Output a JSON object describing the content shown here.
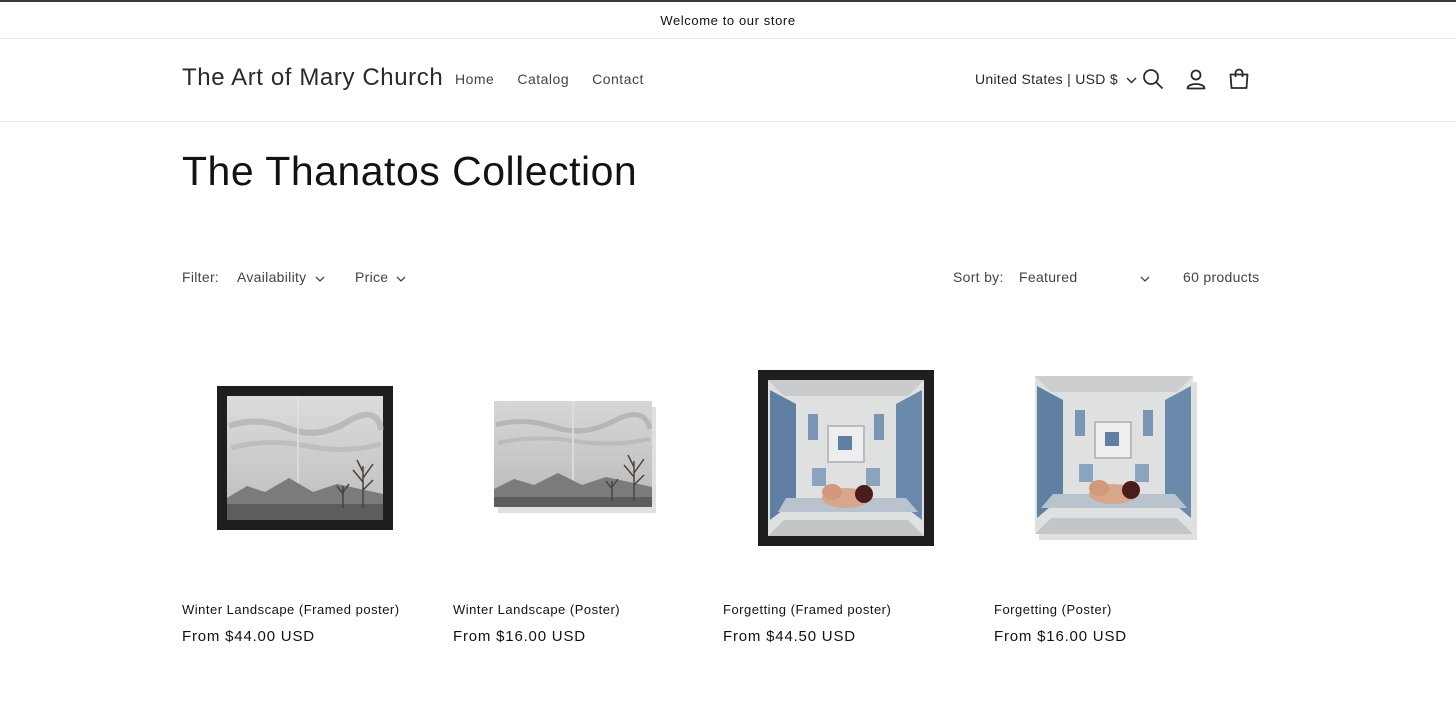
{
  "announcement": {
    "text": "Welcome to our store"
  },
  "header": {
    "logo": "The Art of Mary Church",
    "nav": [
      {
        "label": "Home"
      },
      {
        "label": "Catalog"
      },
      {
        "label": "Contact"
      }
    ],
    "locale": "United States | USD $",
    "icons": [
      "search-icon",
      "account-icon",
      "cart-icon",
      "chevron-down-icon"
    ]
  },
  "collection": {
    "title": "The Thanatos Collection",
    "filter_label": "Filter:",
    "filters": [
      {
        "label": "Availability"
      },
      {
        "label": "Price"
      }
    ],
    "sort_label": "Sort by:",
    "sort_value": "Featured",
    "product_count": "60 products"
  },
  "products": [
    {
      "name": "Winter Landscape (Framed poster)",
      "price": "From $44.00 USD"
    },
    {
      "name": "Winter Landscape (Poster)",
      "price": "From $16.00 USD"
    },
    {
      "name": "Forgetting (Framed poster)",
      "price": "From $44.50 USD"
    },
    {
      "name": "Forgetting (Poster)",
      "price": "From $16.00 USD"
    }
  ],
  "colors": {
    "text": "#121212",
    "muted": "#444444",
    "frame": "#1e1e1e",
    "wall_blue": "#5f7fa3",
    "border": "#e6e6e6"
  }
}
